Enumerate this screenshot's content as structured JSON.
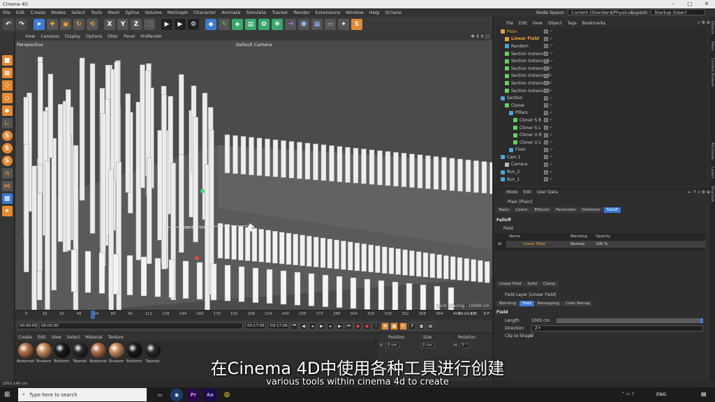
{
  "window": {
    "title": "Cinema 4D"
  },
  "menu": {
    "items": [
      "File",
      "Edit",
      "Create",
      "Modes",
      "Select",
      "Tools",
      "Mesh",
      "Spline",
      "Volume",
      "MoGraph",
      "Character",
      "Animate",
      "Simulate",
      "Tracker",
      "Render",
      "Extensions",
      "Window",
      "Help",
      "Octane"
    ],
    "node_space_label": "Node Space:",
    "node_space_value": "Current (Standard/Physical)",
    "layout_label": "Layout:",
    "layout_value": "Startup (User)"
  },
  "viewport": {
    "menu": [
      "View",
      "Cameras",
      "Display",
      "Options",
      "Filter",
      "Panel",
      "ProRender"
    ],
    "projection": "Perspective",
    "camera": "Default Camera",
    "grid_spacing": "Grid Spacing : 10000 cm",
    "coord_readout": "1128.534 cm"
  },
  "timeline": {
    "ticks": [
      "0",
      "16",
      "32",
      "48",
      "64",
      "80",
      "96",
      "112",
      "128",
      "144",
      "160",
      "176",
      "192",
      "208",
      "224",
      "240",
      "256",
      "272",
      "288",
      "304",
      "320",
      "336",
      "352",
      "368",
      "384",
      "400",
      "416"
    ],
    "current_frame": "0 F",
    "start": "00:00:00",
    "min": "00:00:00",
    "end": "00:17:06",
    "max": "00:17:06",
    "current_time": "00:02:17"
  },
  "materials": {
    "menu": [
      "Create",
      "Edit",
      "View",
      "Select",
      "Material",
      "Texture"
    ],
    "items": [
      {
        "name": "Bodymat",
        "color": "#b4714c"
      },
      {
        "name": "Shoesm",
        "color": "#c88b5e"
      },
      {
        "name": "Bottomr",
        "color": "#1b1b1b"
      },
      {
        "name": "Topmat",
        "color": "#2a2a2a"
      },
      {
        "name": "Bodymat",
        "color": "#b4714c"
      },
      {
        "name": "Shoesm",
        "color": "#c88b5e"
      },
      {
        "name": "Bottomr",
        "color": "#1b1b1b"
      },
      {
        "name": "Topmat",
        "color": "#2a2a2a"
      }
    ]
  },
  "coordinates": {
    "headers": [
      "Position",
      "Size",
      "Rotation"
    ],
    "x_label": "X",
    "x_pos": "0 cm",
    "x_size": "0 cm",
    "h_label": "H",
    "h_rot": "0 °"
  },
  "status": {
    "text": "1950.146 cm"
  },
  "objects": {
    "menu": [
      "File",
      "Edit",
      "View",
      "Object",
      "Tags",
      "Bookmarks"
    ],
    "rows": [
      {
        "name": "Plain",
        "indent": 0,
        "color": "#e9a23b",
        "highlight": true
      },
      {
        "name": "Linear Field",
        "indent": 1,
        "color": "#e9a23b",
        "highlight": true
      },
      {
        "name": "Random",
        "indent": 1,
        "color": "#4aa8d8",
        "highlight": false
      },
      {
        "name": "Section Instance",
        "indent": 1,
        "color": "#5fd35f",
        "highlight": false
      },
      {
        "name": "Section Instance.1",
        "indent": 1,
        "color": "#5fd35f",
        "highlight": false
      },
      {
        "name": "Section Instance.2",
        "indent": 1,
        "color": "#5fd35f",
        "highlight": false
      },
      {
        "name": "Section Instance.3",
        "indent": 1,
        "color": "#5fd35f",
        "highlight": false
      },
      {
        "name": "Section Instance.4",
        "indent": 1,
        "color": "#5fd35f",
        "highlight": false
      },
      {
        "name": "Section Instance.5",
        "indent": 1,
        "color": "#5fd35f",
        "highlight": false
      },
      {
        "name": "Section",
        "indent": 0,
        "color": "#4aa8d8",
        "highlight": false
      },
      {
        "name": "Cloner",
        "indent": 1,
        "color": "#5fd35f",
        "highlight": false
      },
      {
        "name": "Pillars",
        "indent": 2,
        "color": "#4aa8d8",
        "highlight": false
      },
      {
        "name": "Cloner S R",
        "indent": 3,
        "color": "#5fd35f",
        "highlight": false
      },
      {
        "name": "Cloner S L",
        "indent": 3,
        "color": "#5fd35f",
        "highlight": false
      },
      {
        "name": "Cloner U R",
        "indent": 3,
        "color": "#5fd35f",
        "highlight": false
      },
      {
        "name": "Cloner U L",
        "indent": 3,
        "color": "#5fd35f",
        "highlight": false
      },
      {
        "name": "Floor",
        "indent": 2,
        "color": "#4aa8d8",
        "highlight": false
      },
      {
        "name": "Cam 1",
        "indent": 0,
        "color": "#4aa8d8",
        "highlight": false
      },
      {
        "name": "Camera",
        "indent": 1,
        "color": "#bbbbbb",
        "highlight": false
      },
      {
        "name": "Run_2",
        "indent": 0,
        "color": "#4aa8d8",
        "highlight": false
      },
      {
        "name": "Run_1",
        "indent": 0,
        "color": "#4aa8d8",
        "highlight": false
      }
    ]
  },
  "attributes": {
    "menu": [
      "Mode",
      "Edit",
      "User Data"
    ],
    "object_title": "Plain [Plain]",
    "tabs": [
      "Basic",
      "Coord.",
      "Effector",
      "Parameter",
      "Deformer",
      "Falloff"
    ],
    "active_tab": "Falloff",
    "section_falloff": "Falloff",
    "field_label": "Field",
    "table_headers": [
      "Name",
      "Blending",
      "Opacity"
    ],
    "table_row": {
      "name": "Linear Field",
      "blending": "Normal",
      "opacity": "100 %"
    },
    "field_buttons": [
      "Linear Field",
      "Solid",
      "Clamp"
    ],
    "layer_title": "Field Layer [Linear Field]",
    "layer_tabs": [
      "Blending",
      "Field",
      "Remapping",
      "Color Remap"
    ],
    "layer_active_tab": "Field",
    "field_section": "Field",
    "length_label": "Length",
    "length_value": "1000 cm",
    "length_fraction": 1.0,
    "direction_label": "Direction",
    "direction_value": "Z+",
    "clip_label": "Clip to Shape"
  },
  "side_tabs": [
    "Objects",
    "Takes",
    "Content Browser",
    "Attributes",
    "Layers",
    "Structure"
  ],
  "subtitles": {
    "cn": "在Cinema 4D中使用各种工具进行创建",
    "en": "various tools within cinema 4d to create"
  },
  "taskbar": {
    "search_placeholder": "Type here to search",
    "apps": [
      {
        "name": "Pr",
        "color": "#2a0a4a",
        "text": "#e08bff"
      },
      {
        "name": "Ae",
        "color": "#1f0a4a",
        "text": "#a0a0ff"
      }
    ],
    "lang": "ENG"
  }
}
